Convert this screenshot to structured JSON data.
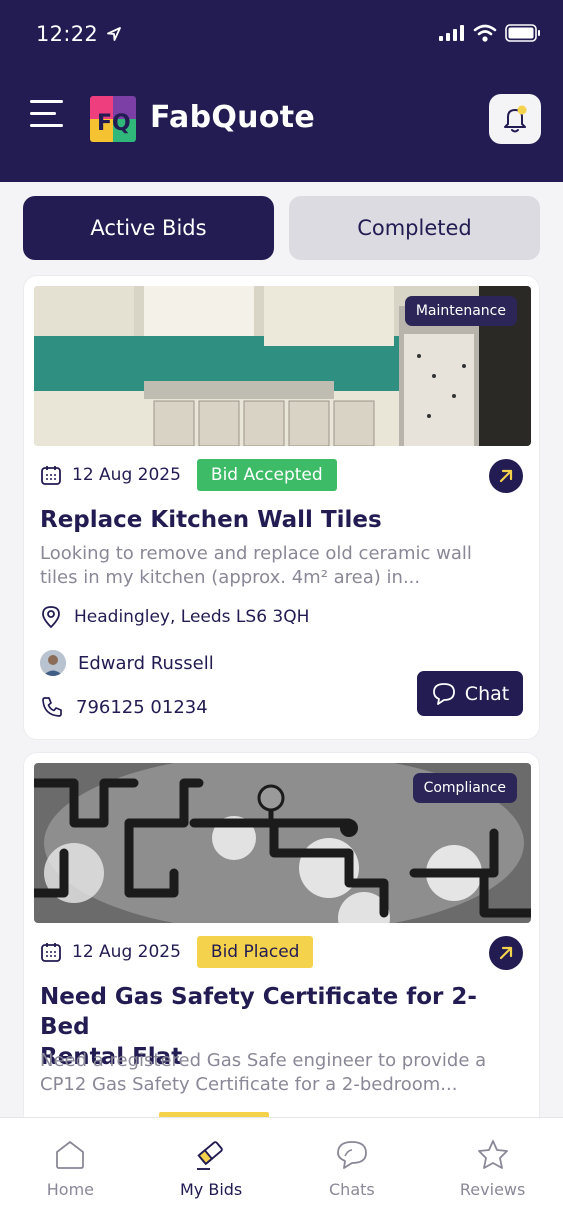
{
  "status_bar": {
    "time": "12:22"
  },
  "header": {
    "app_name": "FabQuote",
    "logo_letters": "FQ"
  },
  "tabs": [
    {
      "label": "Active Bids",
      "active": true
    },
    {
      "label": "Completed",
      "active": false
    }
  ],
  "bids": [
    {
      "category": "Maintenance",
      "date": "12 Aug 2025",
      "status": "Bid Accepted",
      "status_color": "#3dbb67",
      "title": "Replace Kitchen Wall Tiles",
      "description_line1": "Looking to remove and replace old ceramic wall",
      "description_line2": "tiles in my kitchen (approx. 4m² area) in...",
      "location": "Headingley, Leeds LS6 3QH",
      "customer": "Edward Russell",
      "phone": "796125 01234",
      "chat_label": "Chat"
    },
    {
      "category": "Compliance",
      "date": "12 Aug 2025",
      "status": "Bid Placed",
      "status_color": "#f5d24c",
      "title_line1": "Need Gas Safety Certificate for 2-Bed",
      "title_line2": "Rental Flat",
      "description_line1": "Need a registered Gas Safe engineer to provide a",
      "description_line2": "CP12 Gas Safety Certificate for a 2-bedroom..."
    }
  ],
  "bottom_nav": [
    {
      "label": "Home",
      "icon": "home-icon",
      "active": false
    },
    {
      "label": "My Bids",
      "icon": "bids-icon",
      "active": true
    },
    {
      "label": "Chats",
      "icon": "chats-icon",
      "active": false
    },
    {
      "label": "Reviews",
      "icon": "reviews-icon",
      "active": false
    }
  ],
  "colors": {
    "primary": "#221c52",
    "accent": "#f5d24c",
    "success": "#3dbb67"
  }
}
